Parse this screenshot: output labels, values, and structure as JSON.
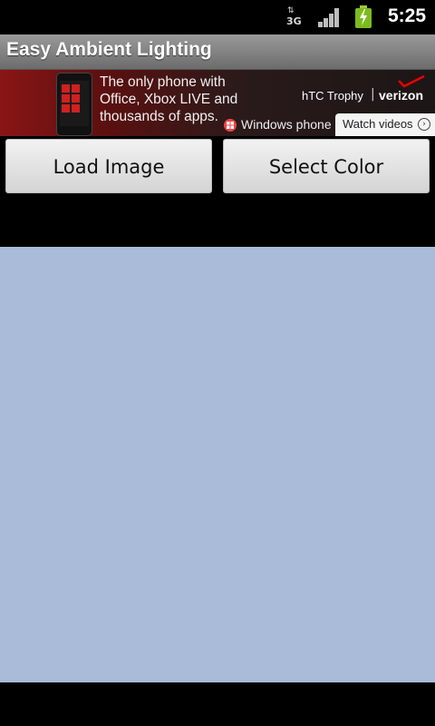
{
  "status_bar": {
    "network_type": "3G",
    "time": "5:25"
  },
  "app": {
    "title": "Easy Ambient Lighting"
  },
  "ad": {
    "copy_line1": "The only phone with",
    "copy_line2": "Office, Xbox LIVE and",
    "copy_line3": "thousands of apps.",
    "brand_htc": "hTC Trophy",
    "brand_separator": "|",
    "brand_verizon": "verizon",
    "windows_phone": "Windows phone",
    "watch_label": "Watch videos"
  },
  "buttons": {
    "load_image": "Load Image",
    "select_color": "Select Color"
  },
  "colors": {
    "ambient_color": "#aabbd9"
  }
}
